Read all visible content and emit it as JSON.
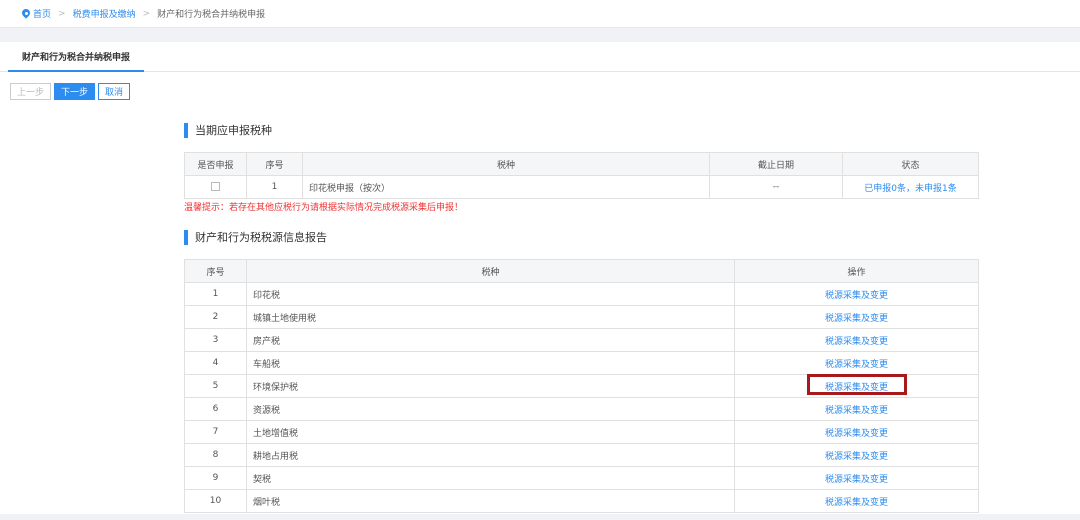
{
  "breadcrumb": {
    "home": "首页",
    "parent": "税费申报及缴纳",
    "current": "财产和行为税合并纳税申报",
    "sep1": ">",
    "sep2": ">"
  },
  "tab": {
    "label": "财产和行为税合并纳税申报"
  },
  "toolbar": {
    "prev": "上一步",
    "next": "下一步",
    "cancel": "取消"
  },
  "section1": {
    "title": "当期应申报税种",
    "headers": [
      "是否申报",
      "序号",
      "税种",
      "截止日期",
      "状态"
    ],
    "rows": [
      {
        "no": "1",
        "tax": "印花税申报（按次）",
        "deadline": "--",
        "status": "已申报0条，未申报1条"
      }
    ]
  },
  "tip": "温馨提示：若存在其他应税行为请根据实际情况完成税源采集后申报！",
  "section2": {
    "title": "财产和行为税税源信息报告",
    "headers": [
      "序号",
      "税种",
      "操作"
    ],
    "action_label": "税源采集及变更",
    "rows": [
      {
        "no": "1",
        "tax": "印花税"
      },
      {
        "no": "2",
        "tax": "城镇土地使用税"
      },
      {
        "no": "3",
        "tax": "房产税"
      },
      {
        "no": "4",
        "tax": "车船税"
      },
      {
        "no": "5",
        "tax": "环境保护税"
      },
      {
        "no": "6",
        "tax": "资源税"
      },
      {
        "no": "7",
        "tax": "土地增值税"
      },
      {
        "no": "8",
        "tax": "耕地占用税"
      },
      {
        "no": "9",
        "tax": "契税"
      },
      {
        "no": "10",
        "tax": "烟叶税"
      }
    ]
  },
  "colors": {
    "accent": "#2d8cf0",
    "warning": "#e33333",
    "highlight": "#a8191c"
  }
}
